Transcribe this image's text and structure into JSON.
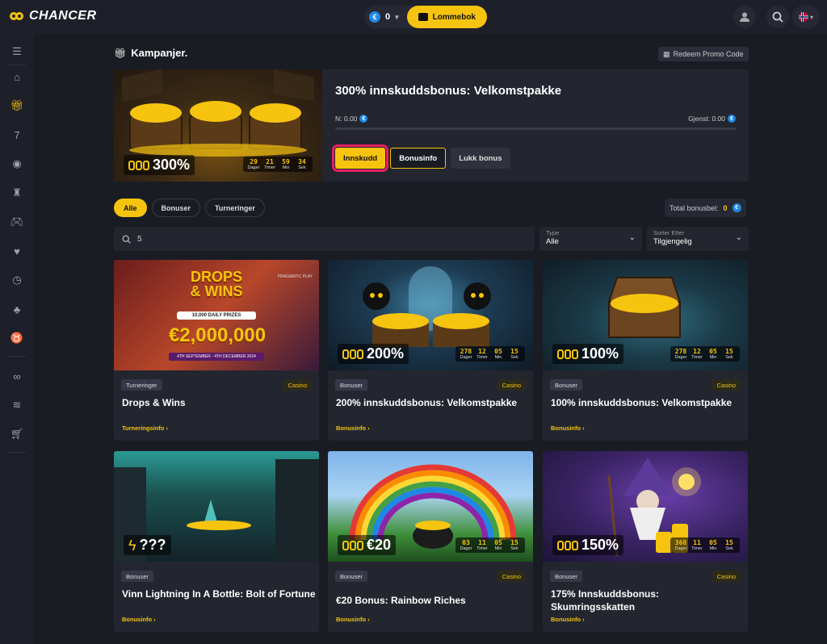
{
  "brand": {
    "name": "CHANCER"
  },
  "wallet": {
    "currency_symbol": "€",
    "balance": "0",
    "button_label": "Lommebok"
  },
  "page": {
    "title": "Kampanjer.",
    "redeem_label": "Redeem Promo Code"
  },
  "hero": {
    "badge": "300%",
    "timer": {
      "values": [
        "29",
        "21",
        "59",
        "34"
      ],
      "labels": [
        "Dager",
        "Timer",
        "Min",
        "Sek"
      ]
    },
    "title": "300% innskuddsbonus: Velkomstpakke",
    "n_label": "N: 0.00",
    "gjenst_label": "Gjenst: 0.00",
    "progress": 0,
    "buttons": {
      "deposit": "Innskudd",
      "info": "Bonusinfo",
      "close": "Lukk bonus"
    }
  },
  "filters": {
    "tabs": [
      "Alle",
      "Bonuser",
      "Turneringer"
    ],
    "active": "Alle"
  },
  "total": {
    "label": "Total bonusbel:",
    "value": "0"
  },
  "search": {
    "value": "5"
  },
  "type_select": {
    "label": "Type",
    "value": "Alle"
  },
  "sort_select": {
    "label": "Sorter Etter",
    "value": "Tilgjengelig"
  },
  "cards": [
    {
      "type": "Turneringer",
      "category": "Casino",
      "title": "Drops & Wins",
      "link": "Turneringsinfo ›",
      "badge": "",
      "timer": null,
      "art": {
        "line1": "DROPS",
        "line2": "& WINS",
        "sub": "10,000 DAILY PRIZES",
        "prize": "€2,000,000",
        "dates": "4TH SEPTEMBER - 4TH DECEMBER 2024",
        "brand": "PRAGMATIC PLAY"
      }
    },
    {
      "type": "Bonuser",
      "category": "Casino",
      "title": "200% innskuddsbonus: Velkomstpakke",
      "link": "Bonusinfo ›",
      "badge": "200%",
      "timer": [
        "278",
        "12",
        "05",
        "15"
      ]
    },
    {
      "type": "Bonuser",
      "category": "Casino",
      "title": "100% innskuddsbonus: Velkomstpakke",
      "link": "Bonusinfo ›",
      "badge": "100%",
      "timer": [
        "278",
        "12",
        "05",
        "15"
      ]
    },
    {
      "type": "Bonuser",
      "category": "",
      "title": "Vinn Lightning In A Bottle: Bolt of Fortune",
      "link": "Bonusinfo ›",
      "badge": "???",
      "timer": null
    },
    {
      "type": "Bonuser",
      "category": "Casino",
      "title": "€20 Bonus: Rainbow Riches",
      "link": "Bonusinfo ›",
      "badge": "€20",
      "timer": [
        "03",
        "11",
        "05",
        "15"
      ]
    },
    {
      "type": "Bonuser",
      "category": "Casino",
      "title": "175% Innskuddsbonus: Skumringsskatten",
      "link": "Bonusinfo ›",
      "badge": "150%",
      "timer": [
        "368",
        "11",
        "05",
        "15"
      ]
    }
  ],
  "timer_labels": [
    "Dager",
    "Timer",
    "Min",
    "Sek"
  ],
  "colors": {
    "accent": "#f6c40f",
    "bg": "#1a1c24",
    "panel": "#23262f"
  }
}
